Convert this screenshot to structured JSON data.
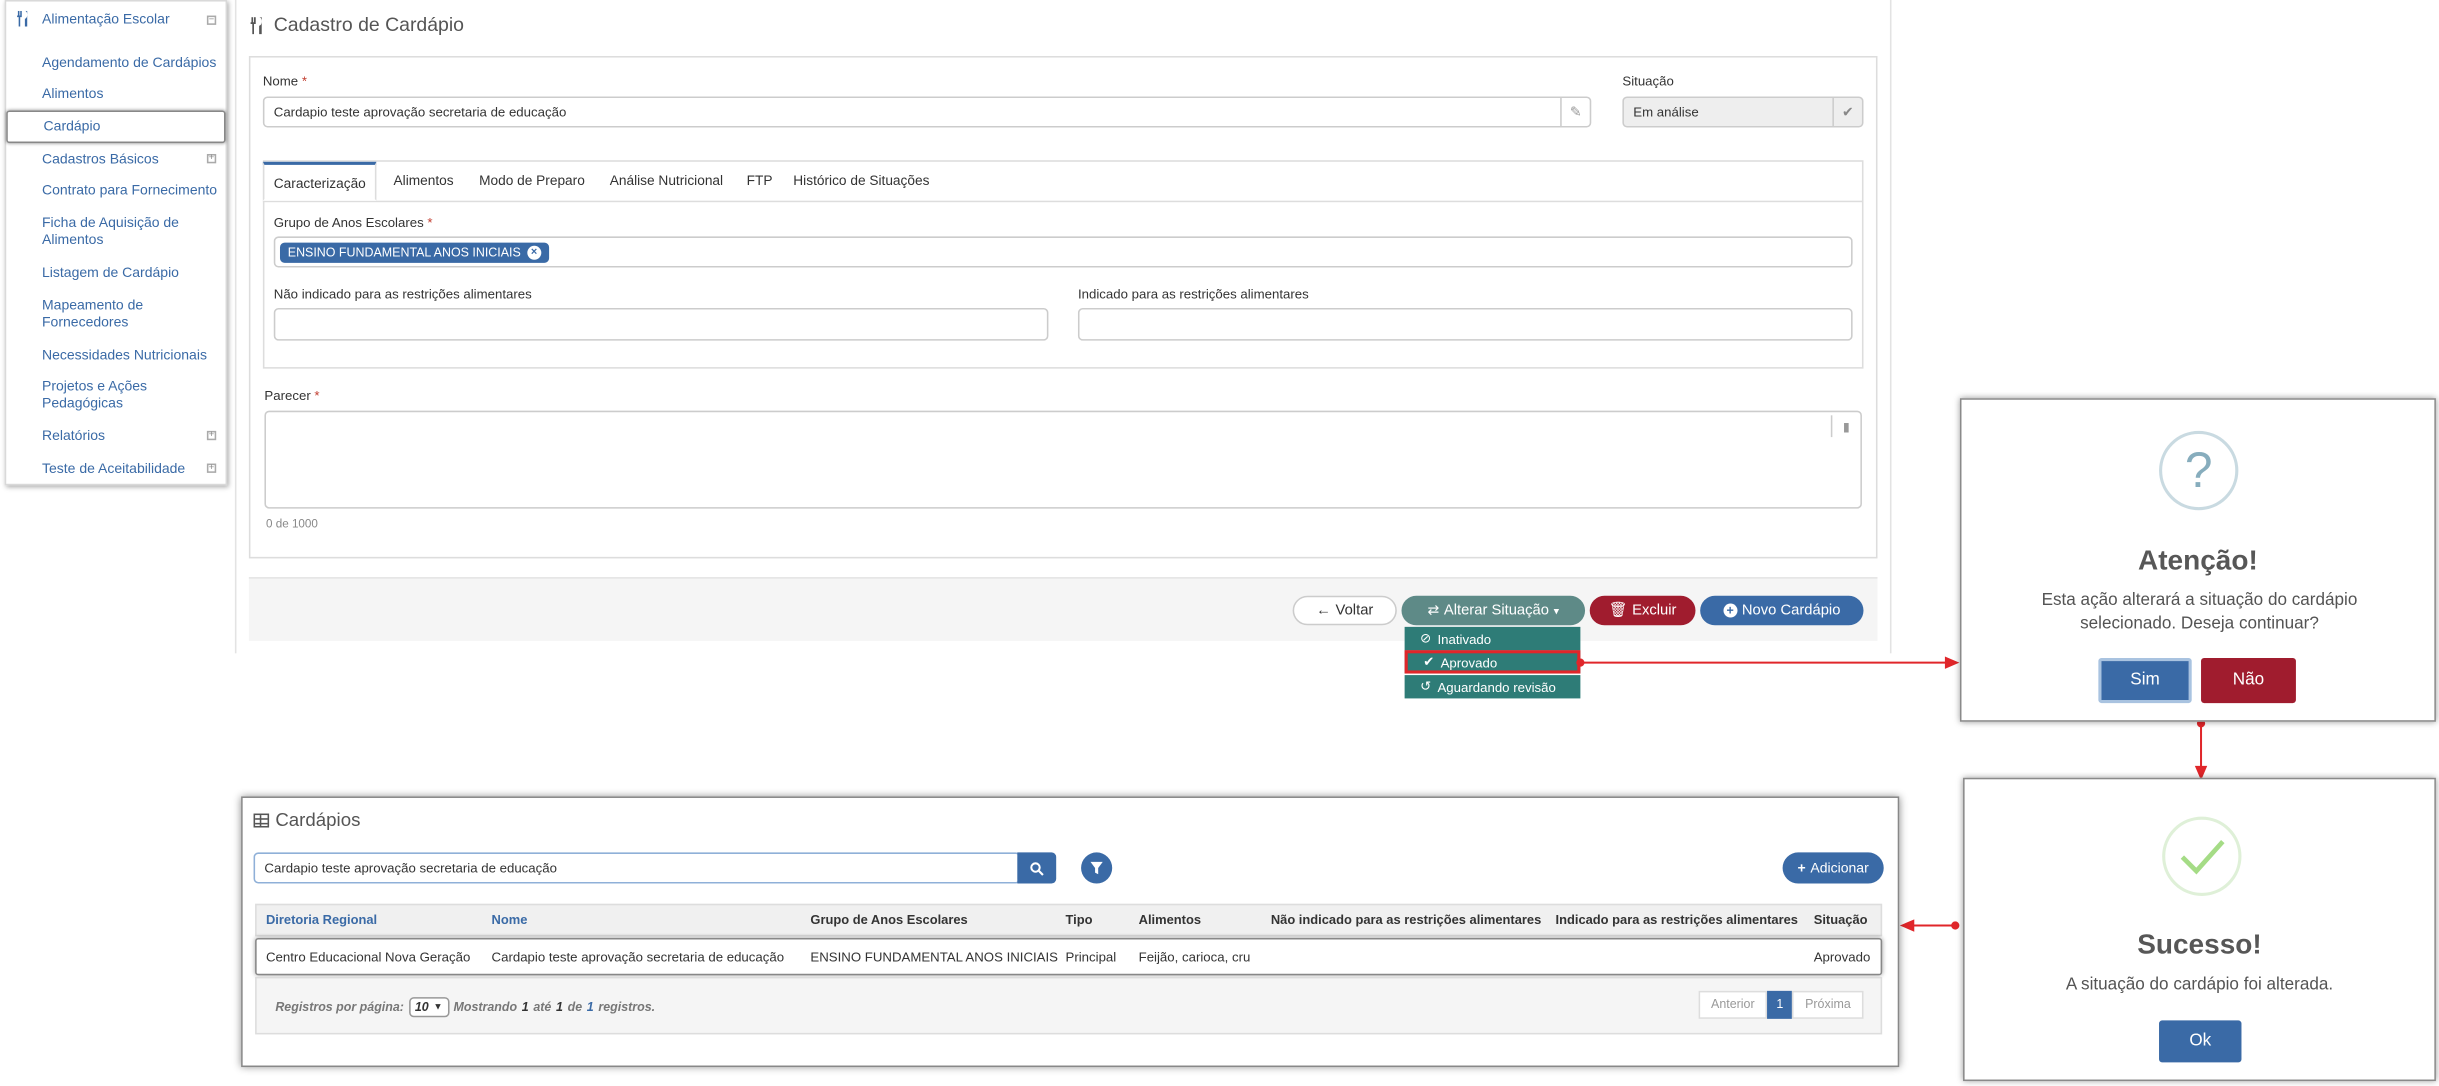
{
  "sidebar": {
    "title": "Alimentação Escolar",
    "items": [
      {
        "label": "Agendamento de Cardápios"
      },
      {
        "label": "Alimentos"
      },
      {
        "label": "Cardápio"
      },
      {
        "label": "Cadastros Básicos"
      },
      {
        "label": "Contrato para Fornecimento"
      },
      {
        "label": "Ficha de Aquisição de Alimentos"
      },
      {
        "label": "Listagem de Cardápio"
      },
      {
        "label": "Mapeamento de Fornecedores"
      },
      {
        "label": "Necessidades Nutricionais"
      },
      {
        "label": "Projetos e Ações Pedagógicas"
      },
      {
        "label": "Relatórios"
      },
      {
        "label": "Teste de Aceitabilidade"
      }
    ]
  },
  "form": {
    "title": "Cadastro de Cardápio",
    "nome_label": "Nome",
    "nome_value": "Cardapio teste aprovação secretaria de educação",
    "situacao_label": "Situação",
    "situacao_value": "Em análise",
    "tabs": [
      {
        "label": "Caracterização"
      },
      {
        "label": "Alimentos"
      },
      {
        "label": "Modo de Preparo"
      },
      {
        "label": "Análise Nutricional"
      },
      {
        "label": "FTP"
      },
      {
        "label": "Histórico de Situações"
      }
    ],
    "grupo_label": "Grupo de Anos Escolares",
    "grupo_chip": "ENSINO FUNDAMENTAL ANOS INICIAIS",
    "nao_indicado_label": "Não indicado para as restrições alimentares",
    "indicado_label": "Indicado para as restrições alimentares",
    "parecer_label": "Parecer",
    "parecer_counter": "0 de 1000"
  },
  "actions": {
    "voltar": "Voltar",
    "alterar": "Alterar Situação",
    "excluir": "Excluir",
    "novo": "Novo Cardápio",
    "menu": [
      {
        "label": "Inativado"
      },
      {
        "label": "Aprovado"
      },
      {
        "label": "Aguardando revisão"
      }
    ]
  },
  "confirm_dialog": {
    "icon": "?",
    "title": "Atenção!",
    "text": "Esta ação alterará a situação do cardápio selecionado. Deseja continuar?",
    "yes": "Sim",
    "no": "Não"
  },
  "success_dialog": {
    "title": "Sucesso!",
    "text": "A situação do cardápio foi alterada.",
    "ok": "Ok"
  },
  "list": {
    "title": "Cardápios",
    "search_value": "Cardapio teste aprovação secretaria de educação",
    "add": "Adicionar",
    "columns": [
      "Diretoria Regional",
      "Nome",
      "Grupo de Anos Escolares",
      "Tipo",
      "Alimentos",
      "Não indicado para as restrições alimentares",
      "Indicado para as restrições alimentares",
      "Situação"
    ],
    "rows": [
      {
        "cells": [
          "Centro Educacional Nova Geração",
          "Cardapio teste aprovação secretaria de educação",
          "ENSINO FUNDAMENTAL ANOS INICIAIS",
          "Principal",
          "Feijão, carioca, cru",
          "",
          "",
          "Aprovado"
        ]
      }
    ],
    "footer": {
      "per_page_label": "Registros por página:",
      "per_page": "10",
      "showing_1": "Mostrando",
      "from": "1",
      "to_word": "até",
      "to": "1",
      "of_word": "de",
      "total": "1",
      "records_word": "registros."
    },
    "pager": {
      "prev": "Anterior",
      "page": "1",
      "next": "Próxima"
    }
  },
  "colors": {
    "accent": "#3a6aa6",
    "danger": "#a01c2e",
    "teal": "#2e7c77",
    "arrow": "#e0262a"
  }
}
